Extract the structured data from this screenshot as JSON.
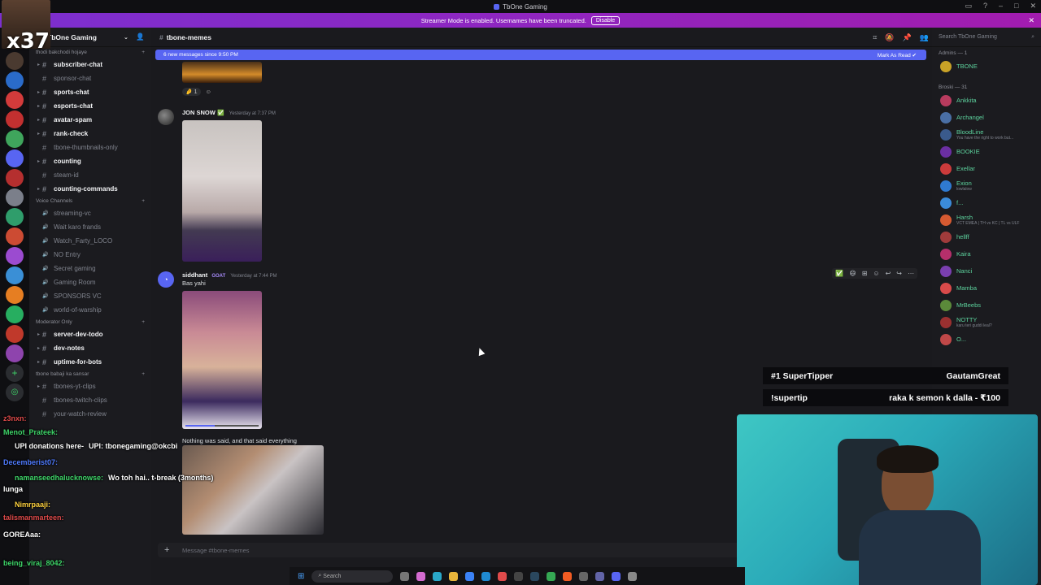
{
  "window": {
    "title": "TbOne Gaming",
    "streamer_notice": "Streamer Mode is enabled. Usernames have been truncated.",
    "disable_label": "Disable"
  },
  "overlay_counter": "x37",
  "server": {
    "name": "TbOne Gaming",
    "categories": [
      {
        "name": "thodi bakchodi hojaye",
        "channels": [
          {
            "name": "subscriber-chat",
            "bold": true,
            "caret": true
          },
          {
            "name": "sponsor-chat",
            "bold": false,
            "caret": false
          },
          {
            "name": "sports-chat",
            "bold": true,
            "caret": true
          },
          {
            "name": "esports-chat",
            "bold": true,
            "caret": true
          },
          {
            "name": "avatar-spam",
            "bold": true,
            "caret": true
          },
          {
            "name": "rank-check",
            "bold": true,
            "caret": true
          },
          {
            "name": "tbone-thumbnails-only",
            "bold": false,
            "caret": false
          },
          {
            "name": "counting",
            "bold": true,
            "caret": true
          },
          {
            "name": "steam-id",
            "bold": false,
            "caret": false
          },
          {
            "name": "counting-commands",
            "bold": true,
            "caret": true
          }
        ]
      },
      {
        "name": "Voice Channels",
        "channels": [
          {
            "name": "streaming-vc",
            "bold": false,
            "caret": false
          },
          {
            "name": "Wait karo frands",
            "bold": false,
            "caret": false
          },
          {
            "name": "Watch_Farty_LOCO",
            "bold": false,
            "caret": false
          },
          {
            "name": "NO Entry",
            "bold": false,
            "caret": false
          },
          {
            "name": "Secret gaming",
            "bold": false,
            "caret": false
          },
          {
            "name": "Gaming Room",
            "bold": false,
            "caret": false
          },
          {
            "name": "SPONSORS VC",
            "bold": false,
            "caret": false
          },
          {
            "name": "world-of-warship",
            "bold": false,
            "caret": false
          }
        ]
      },
      {
        "name": "Moderator Only",
        "channels": [
          {
            "name": "server-dev-todo",
            "bold": true,
            "caret": true
          },
          {
            "name": "dev-notes",
            "bold": true,
            "caret": true
          },
          {
            "name": "uptime-for-bots",
            "bold": true,
            "caret": true
          }
        ]
      },
      {
        "name": "tbone babaji ka sansar",
        "channels": [
          {
            "name": "tbones-yt-clips",
            "bold": false,
            "caret": true
          },
          {
            "name": "tbones-twitch-clips",
            "bold": false,
            "caret": false
          },
          {
            "name": "your-watch-review",
            "bold": false,
            "caret": false
          }
        ]
      }
    ]
  },
  "chat": {
    "channel": "tbone-memes",
    "new_messages": "6 new messages since 9:50 PM",
    "mark_as_read": "Mark As Read",
    "reaction_count": "1",
    "messages": [
      {
        "author": "JON SNOW",
        "timestamp": "Yesterday at 7:37 PM",
        "text": ""
      },
      {
        "author": "siddhant",
        "tag": "GOAT",
        "timestamp": "Yesterday at 7:44 PM",
        "text": "Bas yahi"
      },
      {
        "author": "",
        "timestamp": "",
        "text": "Nothing was said, and that said everything"
      }
    ],
    "composer_placeholder": "Message #tbone-memes"
  },
  "members": {
    "search_placeholder": "Search TbOne Gaming",
    "groups": [
      {
        "label": "Admins — 1",
        "items": [
          {
            "name": "TBONE",
            "status": "",
            "color": "#5dd39e"
          }
        ]
      },
      {
        "label": "Broski — 31",
        "items": [
          {
            "name": "Ankkita",
            "status": "",
            "color": "#5dd39e"
          },
          {
            "name": "Archangel",
            "status": "",
            "color": "#5dd39e"
          },
          {
            "name": "BloodLine",
            "status": "You have the right to work but...",
            "color": "#5dd39e"
          },
          {
            "name": "BOOKIE",
            "status": "",
            "color": "#5dd39e"
          },
          {
            "name": "Exellar",
            "status": "",
            "color": "#5dd39e"
          },
          {
            "name": "Exion",
            "status": "lowlalow",
            "color": "#5dd39e"
          },
          {
            "name": "f...",
            "status": "",
            "color": "#5dd39e"
          },
          {
            "name": "Harsh",
            "status": "VCT EMEA | TH vs KC | TL vs ULF",
            "color": "#5dd39e"
          },
          {
            "name": "hellff",
            "status": "",
            "color": "#5dd39e"
          },
          {
            "name": "Kaira",
            "status": "",
            "color": "#5dd39e"
          },
          {
            "name": "Nanci",
            "status": "",
            "color": "#5dd39e"
          },
          {
            "name": "Mamba",
            "status": "",
            "color": "#5dd39e"
          },
          {
            "name": "MrBeebs",
            "status": "",
            "color": "#5dd39e"
          },
          {
            "name": "NOTTY",
            "status": "karu teri guddi leal?",
            "color": "#5dd39e"
          },
          {
            "name": "O...",
            "status": "",
            "color": "#5dd39e"
          }
        ]
      }
    ]
  },
  "tips": [
    {
      "left": "#1 SuperTipper",
      "right": "GautamGreat"
    },
    {
      "left": "!supertip",
      "right": "raka k semon k dalla - ₹100"
    }
  ],
  "stream_chat": [
    {
      "user": "z3nxn:",
      "text": "",
      "color": "#e04b4b"
    },
    {
      "user": "Menot_Prateek:",
      "text": "",
      "color": "#3fd66a"
    },
    {
      "user": "UPI donations here-",
      "text": "UPI: tbonegaming@okcbi",
      "color": "#ffffff"
    },
    {
      "user": "Decemberist07:",
      "text": "",
      "color": "#4f7bff"
    },
    {
      "user": "namanseedhalucknowse:",
      "text": "Wo toh hai.. t-break (3months)",
      "color": "#3fd66a"
    },
    {
      "user": "lunga",
      "text": "",
      "color": "#ffffff"
    },
    {
      "user": "Nimrpaaji:",
      "text": "",
      "color": "#ffd23f"
    },
    {
      "user": "talismanmarteen:",
      "text": "",
      "color": "#e04b4b"
    },
    {
      "user": "GOREAaa:",
      "text": "",
      "color": "#ffffff"
    },
    {
      "user": "being_viraj_8042:",
      "text": "",
      "color": "#3fd66a"
    }
  ],
  "taskbar": {
    "search_label": "Search"
  },
  "colors": {
    "accent": "#5865f2",
    "streamer_banner": "#8b2fd0",
    "online": "#5dd39e"
  }
}
